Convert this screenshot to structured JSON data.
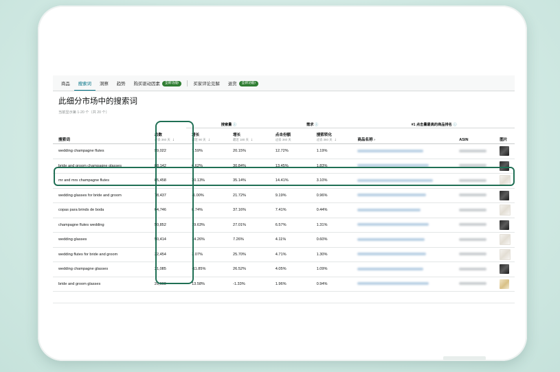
{
  "tabs": [
    {
      "label": "商品"
    },
    {
      "label": "搜索词",
      "active": true
    },
    {
      "label": "洞察"
    },
    {
      "label": "趋势"
    },
    {
      "label": "购买驱动因素",
      "badge": "全新功能!"
    },
    {
      "label": "买家评论见解"
    },
    {
      "label": "退货",
      "badge": "全新功能!"
    }
  ],
  "section": {
    "title": "此细分市场中的搜索词",
    "subtitle": "当前显示第 1-20 个（共 20 个）"
  },
  "group_headers": {
    "search_volume": "搜索量",
    "demand": "需求",
    "top_product": "#1 点击量最高的商品排名"
  },
  "columns": {
    "term": "搜索词",
    "total": "总数",
    "total_sub": "过去 360 天",
    "growth1": "增长",
    "growth1_sub": "最近 90 天",
    "growth2": "增长",
    "growth2_sub": "最近 180 天",
    "click_share": "点击份额",
    "click_share_sub": "过去 360 天",
    "conversion": "搜索转化",
    "conversion_sub": "过去 360 天",
    "product": "商品名称",
    "asin": "ASIN",
    "image": "图片"
  },
  "rows": [
    {
      "term": "wedding champagne flutes",
      "total": "99,022",
      "growth90": "7.59%",
      "growth180": "20.15%",
      "click_share": "12.72%",
      "conversion": "1.19%",
      "thumb": "dark"
    },
    {
      "term": "bride and groom champagne glasses",
      "total": "88,142",
      "growth90": "6.62%",
      "growth180": "30.84%",
      "click_share": "13.45%",
      "conversion": "1.83%",
      "thumb": "dark"
    },
    {
      "term": "mr and mrs champagne flutes",
      "total": "85,458",
      "growth90": "20.13%",
      "growth180": "35.14%",
      "click_share": "14.41%",
      "conversion": "3.10%",
      "thumb": "light"
    },
    {
      "term": "wedding glasses for bride and groom",
      "total": "78,437",
      "growth90": "-1.00%",
      "growth180": "21.72%",
      "click_share": "9.19%",
      "conversion": "0.96%",
      "thumb": "dark"
    },
    {
      "term": "copas para brinds de boda",
      "total": "64,746",
      "growth90": "8.74%",
      "growth180": "37.16%",
      "click_share": "7.41%",
      "conversion": "0.44%",
      "thumb": "light"
    },
    {
      "term": "champagne flutes wedding",
      "total": "50,852",
      "growth90": "19.63%",
      "growth180": "27.01%",
      "click_share": "6.57%",
      "conversion": "1.31%",
      "thumb": "dark"
    },
    {
      "term": "wedding glasses",
      "total": "50,414",
      "growth90": "14.26%",
      "growth180": "7.26%",
      "click_share": "4.11%",
      "conversion": "0.60%",
      "thumb": "light"
    },
    {
      "term": "wedding flutes for bride and groom",
      "total": "32,454",
      "growth90": "3.07%",
      "growth180": "25.70%",
      "click_share": "4.71%",
      "conversion": "1.30%",
      "thumb": "light"
    },
    {
      "term": "wedding champagne glasses",
      "total": "31,085",
      "growth90": "-11.85%",
      "growth180": "26.52%",
      "click_share": "4.05%",
      "conversion": "1.09%",
      "thumb": "dark"
    },
    {
      "term": "bride and groom glasses",
      "total": "29,669",
      "growth90": "13.58%",
      "growth180": "-1.33%",
      "click_share": "1.96%",
      "conversion": "0.94%",
      "thumb": "gold"
    }
  ],
  "colors": {
    "highlight": "#1f6f54",
    "link": "#007185",
    "badge": "#2f7d32"
  }
}
